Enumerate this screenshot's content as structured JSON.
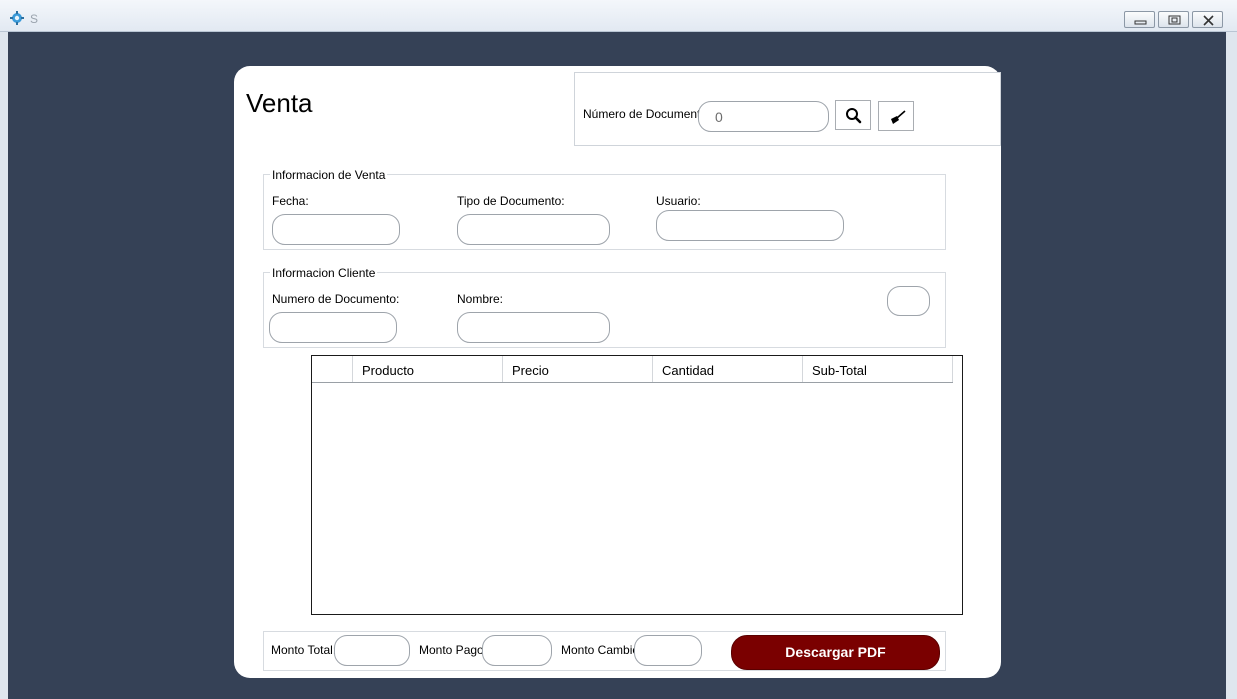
{
  "window": {
    "title": "S",
    "controls": [
      "minimize-icon",
      "restore-icon",
      "close-icon"
    ]
  },
  "page": {
    "title": "Venta"
  },
  "search": {
    "label": "Número de Documento:",
    "value": "0",
    "search_icon": "search-icon",
    "clear_icon": "broom-icon"
  },
  "venta_info": {
    "group_title": "Informacion de Venta",
    "fecha_label": "Fecha:",
    "fecha_value": "",
    "tipo_label": "Tipo de Documento:",
    "tipo_value": "",
    "usuario_label": "Usuario:",
    "usuario_value": ""
  },
  "cliente_info": {
    "group_title": "Informacion Cliente",
    "numero_label": "Numero de Documento:",
    "numero_value": "",
    "nombre_label": "Nombre:",
    "nombre_value": "",
    "extra_value": ""
  },
  "grid": {
    "columns": [
      "",
      "Producto",
      "Precio",
      "Cantidad",
      "Sub-Total"
    ],
    "rows": []
  },
  "totals": {
    "monto_total_label": "Monto Total:",
    "monto_total_value": "",
    "monto_pago_label": "Monto Pago:",
    "monto_pago_value": "",
    "monto_cambio_label": "Monto Cambio:",
    "monto_cambio_value": "",
    "pdf_button": "Descargar PDF"
  },
  "colors": {
    "background": "#354156",
    "pdf_button": "#7a0000"
  }
}
